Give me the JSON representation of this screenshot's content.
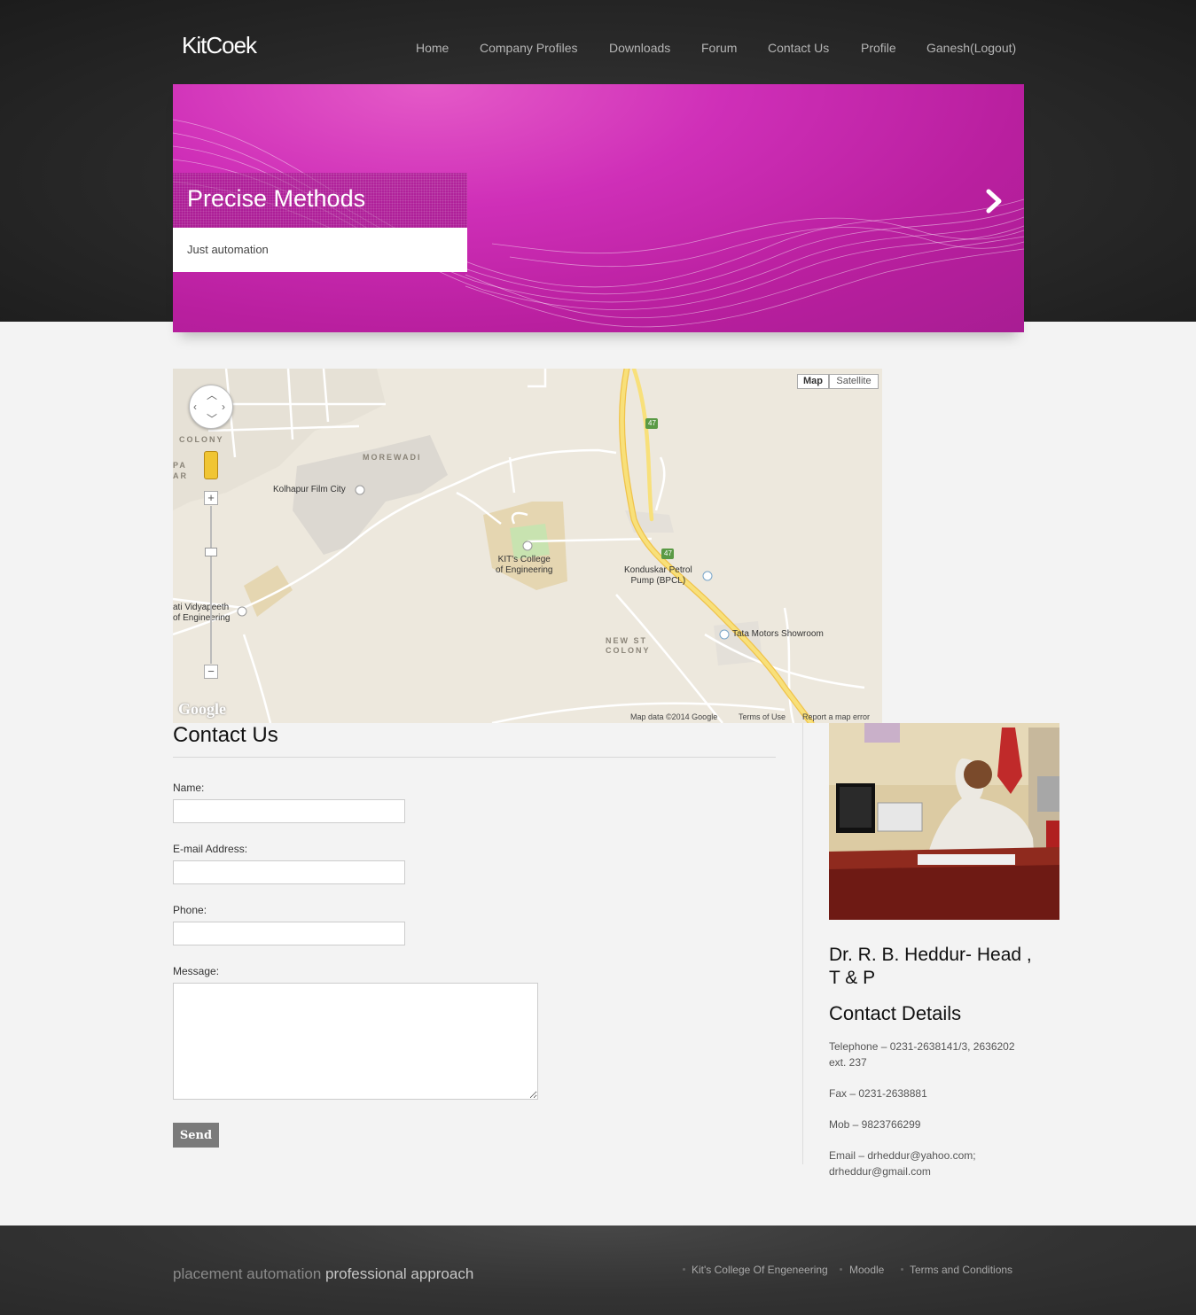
{
  "brand": {
    "logo": "KitCoek"
  },
  "nav": [
    "Home",
    "Company Profiles",
    "Downloads",
    "Forum",
    "Contact Us",
    "Profile",
    "Ganesh(Logout)"
  ],
  "banner": {
    "title": "Precise Methods",
    "subtitle": "Just automation",
    "next_icon": "chevron-right-icon"
  },
  "map": {
    "type_buttons": [
      "Map",
      "Satellite"
    ],
    "labels": {
      "film_city": "Kolhapur Film City",
      "college": "KIT's College\nof Engineering",
      "petrol": "Konduskar Petrol\nPump (BPCL)",
      "tata": "Tata Motors Showroom",
      "vidyapeeth": "ati Vidyapeeth\nof Engineering",
      "colony": "COLONY",
      "morewadi": "MOREWADI",
      "new_st_colony": "NEW ST\nCOLONY",
      "pa": "PA",
      "ar": "AR",
      "highway": "47",
      "highway2": "47"
    },
    "attribution": "Map data ©2014 Google",
    "terms": "Terms of Use",
    "report": "Report a map error",
    "google": "Google",
    "zoom_in": "+",
    "zoom_out": "−"
  },
  "contact": {
    "title": "Contact Us",
    "name_label": "Name:",
    "email_label": "E-mail Address:",
    "phone_label": "Phone:",
    "message_label": "Message:",
    "send_label": "Send"
  },
  "sidebar": {
    "person": "Dr. R. B. Heddur- Head , T & P",
    "details_title": "Contact Details",
    "telephone": "Telephone – 0231-2638141/3, 2636202 ext. 237",
    "fax": "Fax – 0231-2638881",
    "mobile": "Mob – 9823766299",
    "email": "Email – drheddur@yahoo.com; drheddur@gmail.com"
  },
  "footer": {
    "tagline_1": "placement automation",
    "tagline_2": "professional approach",
    "links": [
      "Kit's College Of Engeneering",
      "Moodle",
      "Terms and Conditions"
    ]
  },
  "colors": {
    "banner_magenta": "#c42aad",
    "header_dark": "#2b2b2b",
    "page_bg": "#f3f3f3",
    "highway_yellow": "#f6d35a"
  }
}
